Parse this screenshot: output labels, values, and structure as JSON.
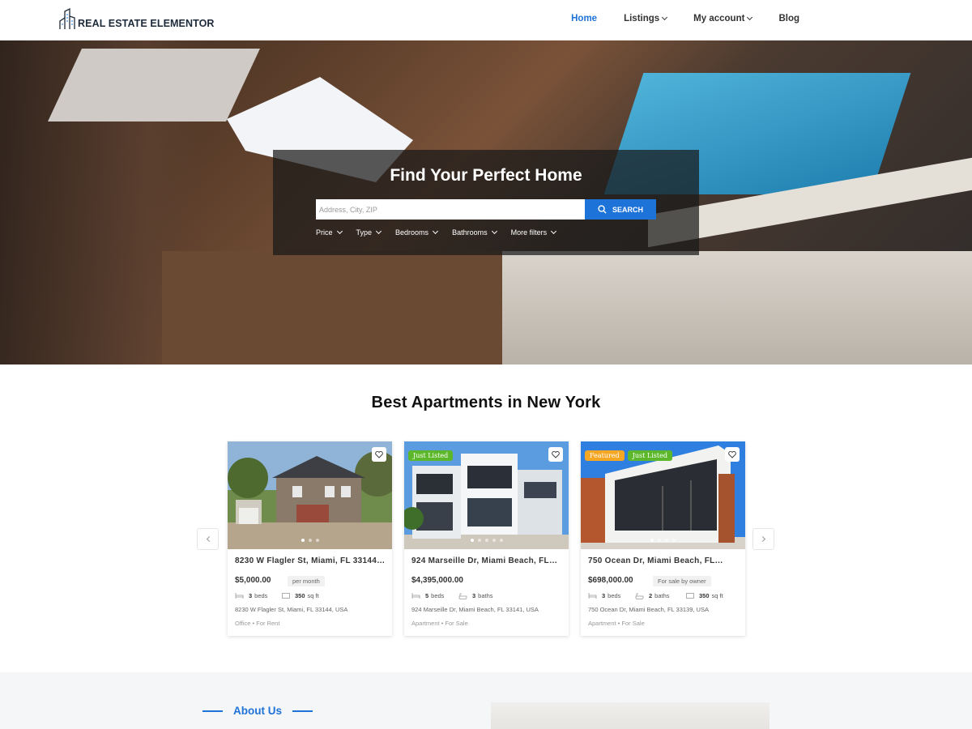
{
  "header": {
    "logo_text": "REAL ESTATE ELEMENTOR",
    "nav": [
      {
        "label": "Home",
        "active": true
      },
      {
        "label": "Listings",
        "dropdown": true
      },
      {
        "label": "My account",
        "dropdown": true
      },
      {
        "label": "Blog"
      }
    ]
  },
  "hero": {
    "title": "Find Your Perfect Home",
    "search_placeholder": "Address, City, ZIP",
    "search_button": "SEARCH",
    "filters": [
      "Price",
      "Type",
      "Bedrooms",
      "Bathrooms",
      "More filters"
    ]
  },
  "section": {
    "title": "Best Apartments in New York"
  },
  "colors": {
    "accent": "#1e73d8",
    "badge_featured": "#f5a623",
    "badge_just_listed": "#5cb82a"
  },
  "listings": [
    {
      "title": "8230 W Flagler St, Miami, FL 33144…",
      "price": "$5,000.00",
      "price_tag": "per month",
      "beds": "3",
      "beds_label": "beds",
      "area": "350",
      "area_label": "sq ft",
      "address": "8230 W Flagler St, Miami, FL 33144, USA",
      "meta": "Office  •  For Rent",
      "badges": []
    },
    {
      "title": "924 Marseille Dr, Miami Beach, FL…",
      "price": "$4,395,000.00",
      "price_tag": "",
      "beds": "5",
      "beds_label": "beds",
      "baths": "3",
      "baths_label": "baths",
      "address": "924 Marseille Dr, Miami Beach, FL 33141, USA",
      "meta": "Apartment  •  For Sale",
      "badges": [
        "Just Listed"
      ]
    },
    {
      "title": "750 Ocean Dr, Miami Beach, FL…",
      "price": "$698,000.00",
      "price_tag": "For sale by owner",
      "beds": "3",
      "beds_label": "beds",
      "baths": "2",
      "baths_label": "baths",
      "area": "350",
      "area_label": "sq ft",
      "address": "750 Ocean Dr, Miami Beach, FL 33139, USA",
      "meta": "Apartment  •  For Sale",
      "badges": [
        "Featured",
        "Just Listed"
      ]
    }
  ],
  "about": {
    "label": "About Us"
  }
}
